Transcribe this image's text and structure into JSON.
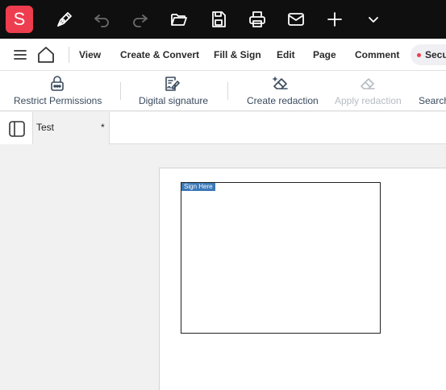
{
  "titlebar": {
    "logo_letter": "S",
    "colors": {
      "background": "#0f0f0f",
      "logo": "#ee3d4f"
    },
    "icons": [
      "pen-icon",
      "undo-icon",
      "redo-icon",
      "folder-open-icon",
      "save-icon",
      "print-icon",
      "mail-icon",
      "plus-icon",
      "chevron-down-icon"
    ]
  },
  "menubar": {
    "items": [
      {
        "label": "View"
      },
      {
        "label": "Create & Convert"
      },
      {
        "label": "Fill & Sign"
      },
      {
        "label": "Edit"
      },
      {
        "label": "Page"
      },
      {
        "label": "Comment"
      }
    ],
    "security_label": "Security",
    "security_dot_color": "#ee3d4f"
  },
  "toolbar": {
    "tools": [
      {
        "label": "Restrict Permissions",
        "icon": "lock-icon",
        "enabled": true
      },
      {
        "label": "Digital signature",
        "icon": "signature-icon",
        "enabled": true
      },
      {
        "label": "Create redaction",
        "icon": "eraser-icon",
        "enabled": true
      },
      {
        "label": "Apply redaction",
        "icon": "eraser-icon",
        "enabled": false
      },
      {
        "label": "Search",
        "icon": "search-icon",
        "enabled": true
      }
    ]
  },
  "sidepanel": {
    "icons": [
      "panel-toggle-icon",
      "bookmark-icon"
    ]
  },
  "document": {
    "tab_title": "Test",
    "tab_modified_marker": "*",
    "signature_field_label": "Sign Here",
    "signature_tag_color": "#3c79b8"
  }
}
